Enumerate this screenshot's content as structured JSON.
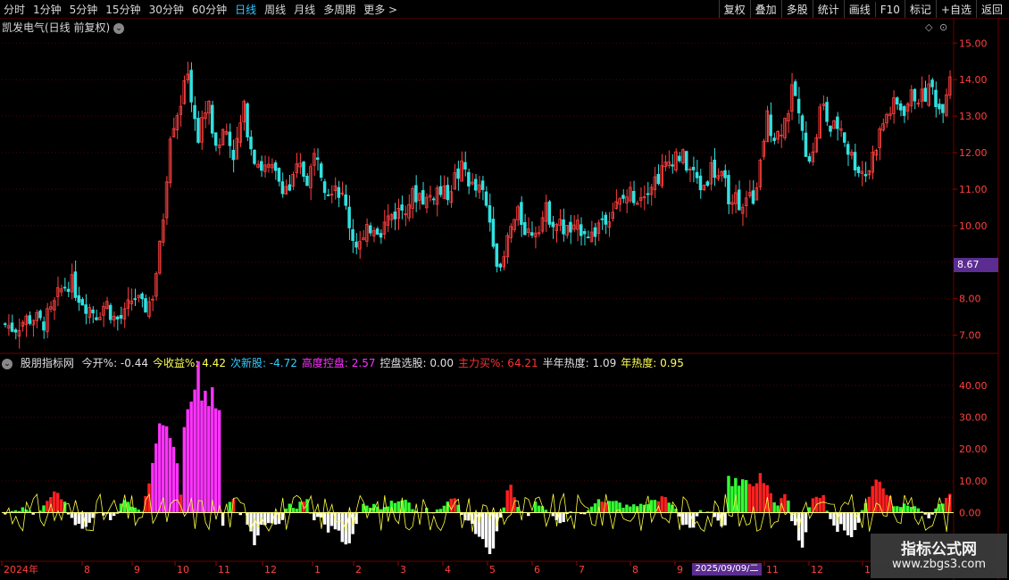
{
  "toolbar": {
    "periods": [
      "分时",
      "1分钟",
      "5分钟",
      "15分钟",
      "30分钟",
      "60分钟",
      "日线",
      "周线",
      "月线",
      "多周期",
      "更多 >"
    ],
    "active_period": "日线",
    "actions": [
      "复权",
      "叠加",
      "多股",
      "统计",
      "画线",
      "F10",
      "标记",
      "+自选",
      "返回"
    ]
  },
  "stock_title": "凯发电气(日线 前复权)",
  "price_axis": [
    "15.00",
    "14.00",
    "13.00",
    "12.00",
    "11.00",
    "10.00",
    "9.00",
    "8.00",
    "7.00"
  ],
  "current_price_tag": "8.67",
  "indicator": {
    "name": "股朋指标网",
    "items": [
      {
        "label": "今开%: -0.44",
        "color": "#e0e0e0"
      },
      {
        "label": "今收益%: 4.42",
        "color": "#ffff55"
      },
      {
        "label": "次新股: -4.72",
        "color": "#33ccff"
      },
      {
        "label": "高度控盘: 2.57",
        "color": "#ff33ff"
      },
      {
        "label": "控盘选股: 0.00",
        "color": "#e0e0e0"
      },
      {
        "label": "主力买%: 64.21",
        "color": "#ff3333"
      },
      {
        "label": "半年热度: 1.09",
        "color": "#e0e0e0"
      },
      {
        "label": "年热度: 0.95",
        "color": "#ffff55"
      }
    ],
    "axis": [
      "40.00",
      "30.00",
      "20.00",
      "10.00",
      "0.00"
    ]
  },
  "date_axis": [
    "2024年",
    "8",
    "9",
    "10",
    "11",
    "12",
    "1",
    "2",
    "3",
    "4",
    "5",
    "6",
    "7",
    "8",
    "9",
    "11",
    "12",
    "1"
  ],
  "crosshair_date": "2025/09/09/二",
  "colors": {
    "up": "#ff4040",
    "down": "#33e0e0",
    "grid": "#5a0000"
  },
  "watermark": {
    "line1": "指标公式网",
    "line2": "www.zbgs3.com"
  },
  "chart_data": {
    "type": "candlestick",
    "price_ylim": [
      6.6,
      15.3
    ],
    "close_path": [
      7.3,
      7.2,
      7.4,
      7.5,
      7.3,
      7.6,
      8.2,
      8.5,
      8.1,
      7.8,
      7.6,
      7.9,
      7.4,
      7.5,
      8.1,
      7.7,
      8.0,
      9.6,
      12.6,
      13.3,
      14.1,
      12.3,
      13.5,
      12.1,
      12.7,
      11.9,
      13.2,
      12.0,
      11.6,
      11.5,
      11.2,
      11.0,
      11.6,
      11.3,
      12.1,
      11.0,
      11.2,
      10.6,
      9.6,
      9.5,
      10.1,
      9.9,
      10.3,
      10.4,
      10.7,
      10.9,
      10.7,
      11.0,
      10.8,
      11.3,
      11.6,
      11.0,
      10.9,
      10.0,
      8.6,
      9.9,
      10.3,
      9.8,
      10.0,
      10.4,
      10.1,
      9.9,
      9.8,
      10.0,
      9.7,
      10.2,
      10.4,
      10.6,
      10.9,
      10.8,
      11.1,
      11.3,
      11.6,
      12.0,
      11.8,
      11.4,
      11.0,
      11.6,
      11.3,
      10.8,
      10.7,
      10.6,
      11.0,
      13.0,
      12.4,
      12.9,
      13.8,
      12.3,
      11.8,
      13.4,
      12.6,
      12.8,
      12.0,
      11.6,
      11.4,
      12.3,
      13.0,
      13.3,
      13.2,
      13.6,
      13.5,
      13.8,
      13.1,
      14.2
    ],
    "indicator_ylim": [
      -15,
      45
    ]
  }
}
